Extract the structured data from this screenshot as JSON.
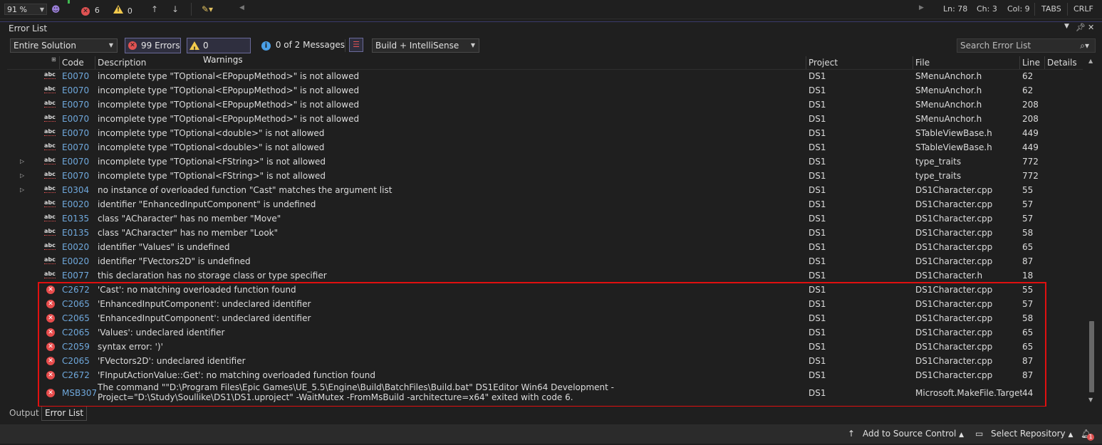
{
  "top_status": {
    "zoom": "91 %",
    "error_count": "6",
    "warning_count": "0",
    "ln": "Ln: 78",
    "ch": "Ch: 3",
    "col": "Col: 9",
    "tabs": "TABS",
    "eol": "CRLF"
  },
  "panel": {
    "title": "Error List",
    "scope": "Entire Solution",
    "errors_filter": "99 Errors",
    "warnings_filter": "0 Warnings",
    "messages_filter": "0 of 2 Messages",
    "build_mode": "Build + IntelliSense",
    "search_placeholder": "Search Error List"
  },
  "columns": {
    "code": "Code",
    "description": "Description",
    "project": "Project",
    "file": "File",
    "line": "Line",
    "details": "Details"
  },
  "rows": [
    {
      "kind": "intellisense",
      "expand": false,
      "code": "E0070",
      "description": "incomplete type \"TOptional<EPopupMethod>\" is not allowed",
      "project": "DS1",
      "file": "SMenuAnchor.h",
      "line": "62"
    },
    {
      "kind": "intellisense",
      "expand": false,
      "code": "E0070",
      "description": "incomplete type \"TOptional<EPopupMethod>\" is not allowed",
      "project": "DS1",
      "file": "SMenuAnchor.h",
      "line": "62"
    },
    {
      "kind": "intellisense",
      "expand": false,
      "code": "E0070",
      "description": "incomplete type \"TOptional<EPopupMethod>\" is not allowed",
      "project": "DS1",
      "file": "SMenuAnchor.h",
      "line": "208"
    },
    {
      "kind": "intellisense",
      "expand": false,
      "code": "E0070",
      "description": "incomplete type \"TOptional<EPopupMethod>\" is not allowed",
      "project": "DS1",
      "file": "SMenuAnchor.h",
      "line": "208"
    },
    {
      "kind": "intellisense",
      "expand": false,
      "code": "E0070",
      "description": "incomplete type \"TOptional<double>\" is not allowed",
      "project": "DS1",
      "file": "STableViewBase.h",
      "line": "449"
    },
    {
      "kind": "intellisense",
      "expand": false,
      "code": "E0070",
      "description": "incomplete type \"TOptional<double>\" is not allowed",
      "project": "DS1",
      "file": "STableViewBase.h",
      "line": "449"
    },
    {
      "kind": "intellisense",
      "expand": true,
      "code": "E0070",
      "description": "incomplete type \"TOptional<FString>\" is not allowed",
      "project": "DS1",
      "file": "type_traits",
      "line": "772"
    },
    {
      "kind": "intellisense",
      "expand": true,
      "code": "E0070",
      "description": "incomplete type \"TOptional<FString>\" is not allowed",
      "project": "DS1",
      "file": "type_traits",
      "line": "772"
    },
    {
      "kind": "intellisense",
      "expand": true,
      "code": "E0304",
      "description": "no instance of overloaded function \"Cast\" matches the argument list",
      "project": "DS1",
      "file": "DS1Character.cpp",
      "line": "55"
    },
    {
      "kind": "intellisense",
      "expand": false,
      "code": "E0020",
      "description": "identifier \"EnhancedInputComponent\" is undefined",
      "project": "DS1",
      "file": "DS1Character.cpp",
      "line": "57"
    },
    {
      "kind": "intellisense",
      "expand": false,
      "code": "E0135",
      "description": "class \"ACharacter\" has no member \"Move\"",
      "project": "DS1",
      "file": "DS1Character.cpp",
      "line": "57"
    },
    {
      "kind": "intellisense",
      "expand": false,
      "code": "E0135",
      "description": "class \"ACharacter\" has no member \"Look\"",
      "project": "DS1",
      "file": "DS1Character.cpp",
      "line": "58"
    },
    {
      "kind": "intellisense",
      "expand": false,
      "code": "E0020",
      "description": "identifier \"Values\" is undefined",
      "project": "DS1",
      "file": "DS1Character.cpp",
      "line": "65"
    },
    {
      "kind": "intellisense",
      "expand": false,
      "code": "E0020",
      "description": "identifier \"FVectors2D\" is undefined",
      "project": "DS1",
      "file": "DS1Character.cpp",
      "line": "87"
    },
    {
      "kind": "intellisense",
      "expand": false,
      "code": "E0077",
      "description": "this declaration has no storage class or type specifier",
      "project": "DS1",
      "file": "DS1Character.h",
      "line": "18"
    },
    {
      "kind": "build",
      "expand": false,
      "code": "C2672",
      "description": "'Cast': no matching overloaded function found",
      "project": "DS1",
      "file": "DS1Character.cpp",
      "line": "55"
    },
    {
      "kind": "build",
      "expand": false,
      "code": "C2065",
      "description": "'EnhancedInputComponent': undeclared identifier",
      "project": "DS1",
      "file": "DS1Character.cpp",
      "line": "57"
    },
    {
      "kind": "build",
      "expand": false,
      "code": "C2065",
      "description": "'EnhancedInputComponent': undeclared identifier",
      "project": "DS1",
      "file": "DS1Character.cpp",
      "line": "58"
    },
    {
      "kind": "build",
      "expand": false,
      "code": "C2065",
      "description": "'Values': undeclared identifier",
      "project": "DS1",
      "file": "DS1Character.cpp",
      "line": "65"
    },
    {
      "kind": "build",
      "expand": false,
      "code": "C2059",
      "description": "syntax error: ')'",
      "project": "DS1",
      "file": "DS1Character.cpp",
      "line": "65"
    },
    {
      "kind": "build",
      "expand": false,
      "code": "C2065",
      "description": "'FVectors2D': undeclared identifier",
      "project": "DS1",
      "file": "DS1Character.cpp",
      "line": "87"
    },
    {
      "kind": "build",
      "expand": false,
      "code": "C2672",
      "description": "'FInputActionValue::Get': no matching overloaded function found",
      "project": "DS1",
      "file": "DS1Character.cpp",
      "line": "87"
    },
    {
      "kind": "build",
      "expand": false,
      "code": "MSB3073",
      "description": "The command \"\"D:\\Program Files\\Epic Games\\UE_5.5\\Engine\\Build\\BatchFiles\\Build.bat\" DS1Editor Win64 Development -Project=\"D:\\Study\\Soullike\\DS1\\DS1.uproject\" -WaitMutex -FromMsBuild -architecture=x64\" exited with code 6.",
      "project": "DS1",
      "file": "Microsoft.MakeFile.Targets",
      "line": "44"
    }
  ],
  "bottom_tabs": {
    "output": "Output",
    "error_list": "Error List"
  },
  "status_bar": {
    "source_control": "Add to Source Control",
    "repository": "Select Repository",
    "notification_count": "1"
  }
}
